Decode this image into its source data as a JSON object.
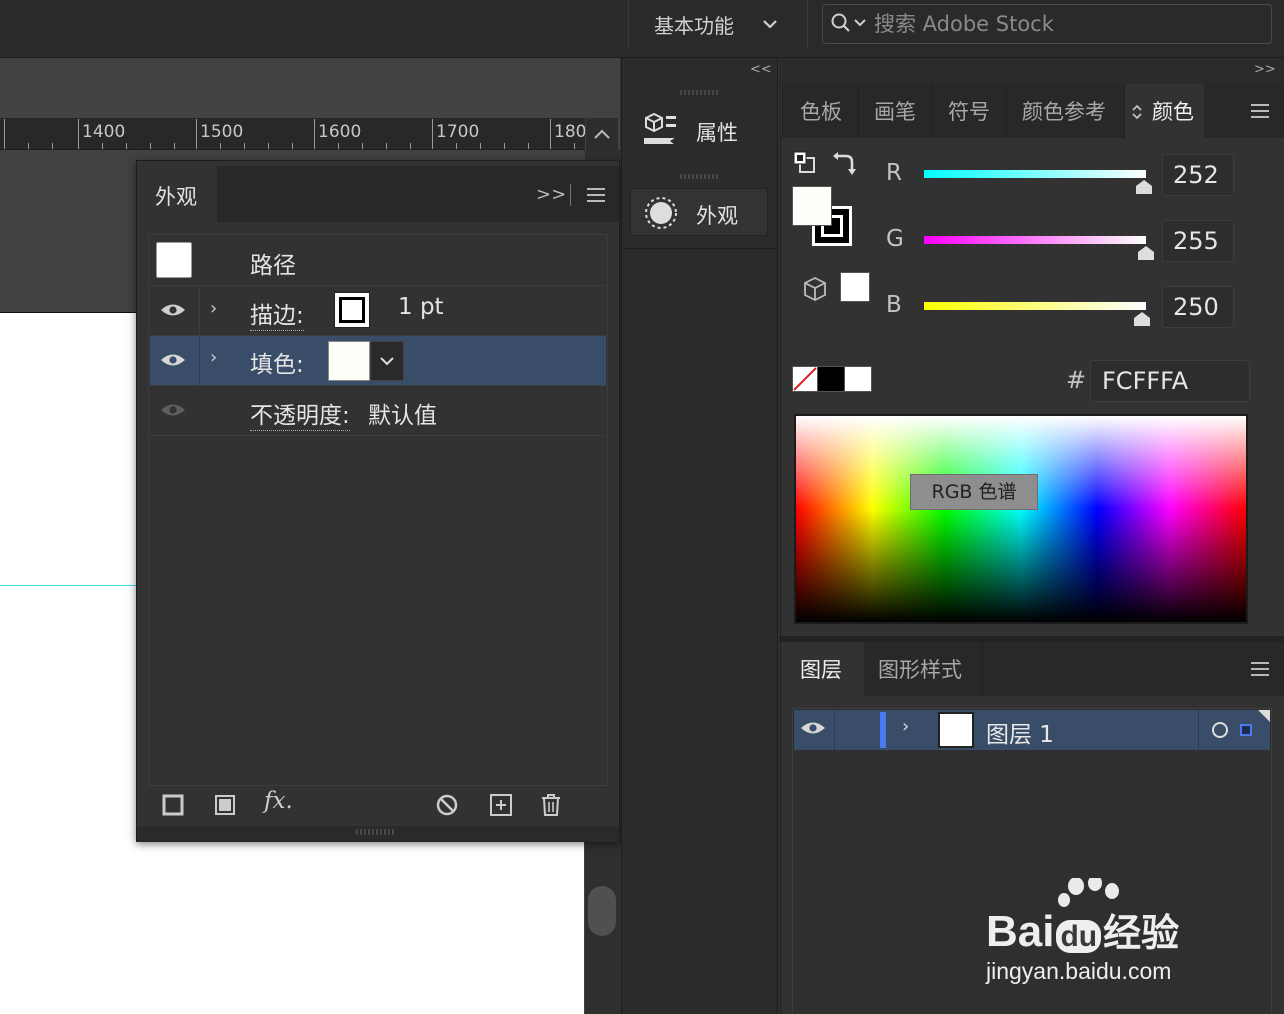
{
  "topbar": {
    "workspace": "基本功能",
    "search_placeholder": "搜索 Adobe Stock"
  },
  "ruler": {
    "labels": [
      "1400",
      "1500",
      "1600",
      "1700",
      "180"
    ]
  },
  "appearance_panel": {
    "tab": "外观",
    "collapse": ">>",
    "path_label": "路径",
    "stroke_label": "描边:",
    "stroke_weight": "1 pt",
    "fill_label": "填色:",
    "opacity_label": "不透明度:",
    "opacity_value": "默认值",
    "fx_label": "fx."
  },
  "mid_dock": {
    "collapse": "<<",
    "properties": "属性",
    "appearance": "外观"
  },
  "color_panel": {
    "collapse": ">>",
    "tabs": [
      "色板",
      "画笔",
      "符号",
      "颜色参考",
      "颜色"
    ],
    "active_tab": "颜色",
    "channels": [
      {
        "label": "R",
        "value": "252"
      },
      {
        "label": "G",
        "value": "255"
      },
      {
        "label": "B",
        "value": "250"
      }
    ],
    "hash": "#",
    "hex": "FCFFFA",
    "spectrum_tooltip": "RGB 色谱",
    "fill_color": "#fcfffa"
  },
  "layers_panel": {
    "tabs": [
      "图层",
      "图形样式"
    ],
    "active_tab": "图层",
    "layers": [
      {
        "name": "图层 1"
      }
    ],
    "layer_color": "#4c79f0"
  },
  "watermark": {
    "brand": "Bai",
    "brand_du": "du",
    "brand_cn": "经验",
    "url": "jingyan.baidu.com"
  }
}
